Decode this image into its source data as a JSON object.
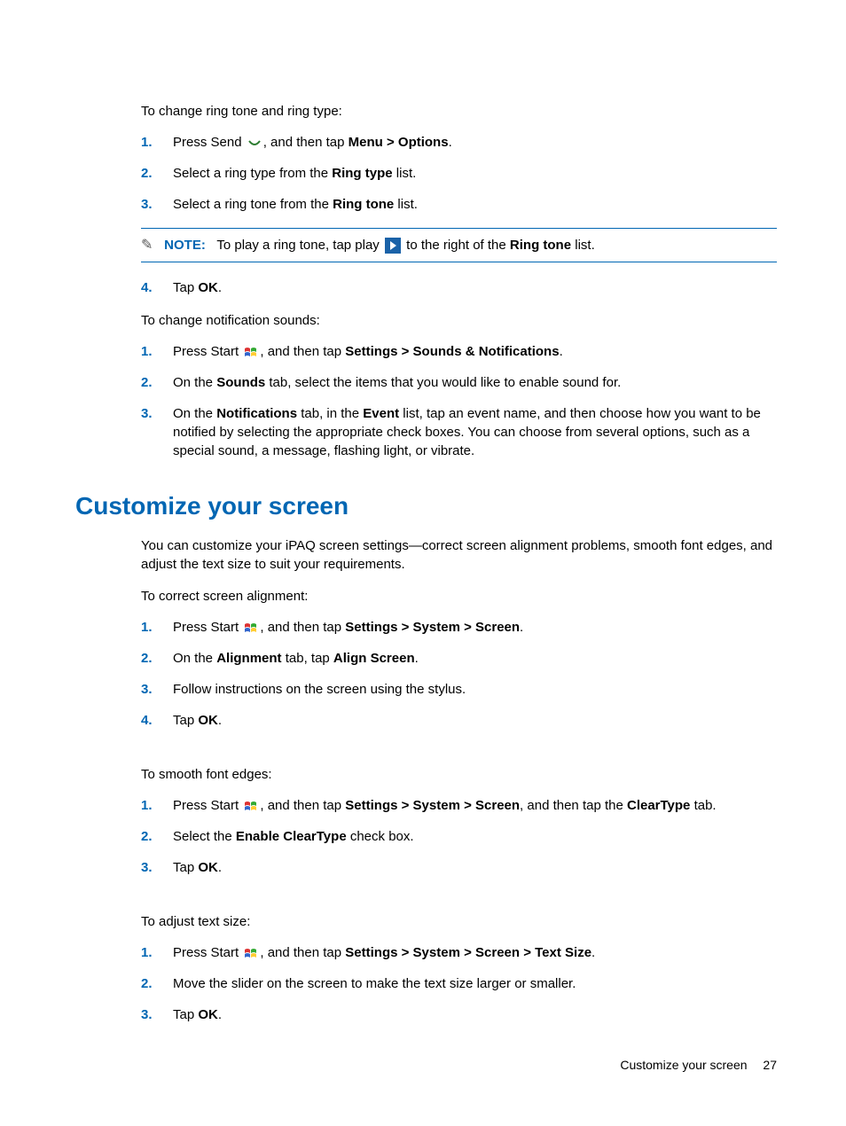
{
  "section1": {
    "intro": "To change ring tone and ring type:",
    "steps": [
      {
        "n": "1.",
        "pre": "Press Send ",
        "icon": "send",
        "mid": ", and then tap ",
        "bold": "Menu > Options",
        "post": "."
      },
      {
        "n": "2.",
        "pre": "Select a ring type from the ",
        "bold": "Ring type",
        "post": " list."
      },
      {
        "n": "3.",
        "pre": "Select a ring tone from the ",
        "bold": "Ring tone",
        "post": " list."
      }
    ],
    "note": {
      "label": "NOTE:",
      "pre": "To play a ring tone, tap play ",
      "mid": " to the right of the ",
      "bold": "Ring tone",
      "post": " list."
    },
    "step4": {
      "n": "4.",
      "pre": "Tap ",
      "bold": "OK",
      "post": "."
    }
  },
  "section2": {
    "intro": "To change notification sounds:",
    "steps": [
      {
        "n": "1.",
        "pre": "Press Start ",
        "icon": "start",
        "mid": ", and then tap ",
        "bold": "Settings > Sounds & Notifications",
        "post": "."
      },
      {
        "n": "2.",
        "pre": "On the ",
        "bold": "Sounds",
        "post": " tab, select the items that you would like to enable sound for."
      },
      {
        "n": "3.",
        "pre": "On the ",
        "bold1": "Notifications",
        "mid1": " tab, in the ",
        "bold2": "Event",
        "post": " list, tap an event name, and then choose how you want to be notified by selecting the appropriate check boxes. You can choose from several options, such as a special sound, a message, flashing light, or vibrate."
      }
    ]
  },
  "heading": "Customize your screen",
  "section3": {
    "intro": "You can customize your iPAQ screen settings—correct screen alignment problems, smooth font edges, and adjust the text size to suit your requirements.",
    "sub1": "To correct screen alignment:",
    "list1": [
      {
        "n": "1.",
        "pre": "Press Start ",
        "icon": "start",
        "mid": ", and then tap ",
        "bold": "Settings > System > Screen",
        "post": "."
      },
      {
        "n": "2.",
        "pre": "On the ",
        "bold1": "Alignment",
        "mid1": " tab, tap ",
        "bold2": "Align Screen",
        "post": "."
      },
      {
        "n": "3.",
        "pre": "Follow instructions on the screen using the stylus."
      },
      {
        "n": "4.",
        "pre": "Tap ",
        "bold": "OK",
        "post": "."
      }
    ],
    "sub2": "To smooth font edges:",
    "list2": [
      {
        "n": "1.",
        "pre": "Press Start ",
        "icon": "start",
        "mid": ", and then tap ",
        "bold1": "Settings > System > Screen",
        "mid1": ", and then tap the ",
        "bold2": "ClearType",
        "post": " tab."
      },
      {
        "n": "2.",
        "pre": "Select the ",
        "bold": "Enable ClearType",
        "post": " check box."
      },
      {
        "n": "3.",
        "pre": "Tap ",
        "bold": "OK",
        "post": "."
      }
    ],
    "sub3": "To adjust text size:",
    "list3": [
      {
        "n": "1.",
        "pre": "Press Start ",
        "icon": "start",
        "mid": ", and then tap ",
        "bold": "Settings > System > Screen > Text Size",
        "post": "."
      },
      {
        "n": "2.",
        "pre": "Move the slider on the screen to make the text size larger or smaller."
      },
      {
        "n": "3.",
        "pre": "Tap ",
        "bold": "OK",
        "post": "."
      }
    ]
  },
  "footer": {
    "title": "Customize your screen",
    "page": "27"
  }
}
